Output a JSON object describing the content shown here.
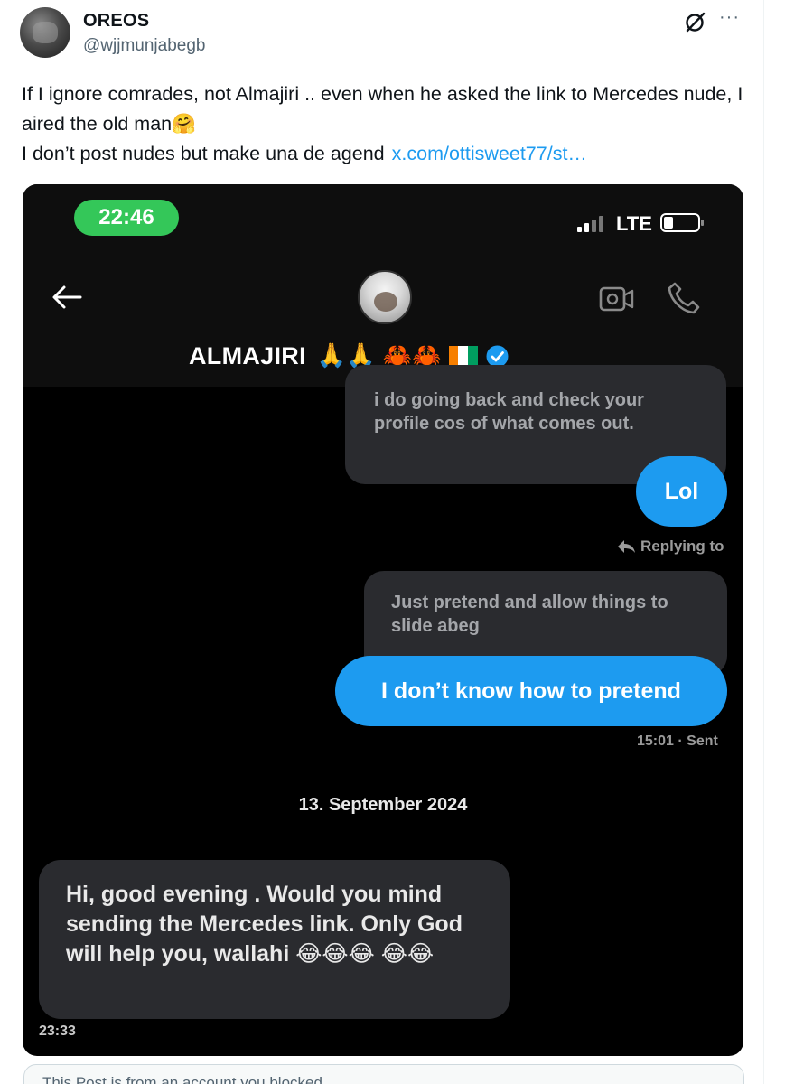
{
  "author": {
    "display_name": "OREOS",
    "handle": "@wjjmunjabegb"
  },
  "icons": {
    "grok": "grok-slash-circle-icon",
    "more": "more-options-icon"
  },
  "tweet": {
    "text": "If I ignore comrades, not Almajiri .. even when he asked the link to Mercedes nude, I aired the old man🤗\nI don’t post nudes but make una de agend",
    "link": "x.com/ottisweet77/st…"
  },
  "media": {
    "status_bar": {
      "time": "22:46",
      "network": "LTE"
    },
    "contact": {
      "name": "ALMAJIRI",
      "emoji_tail": "🙏🙏 🦀🦀"
    },
    "messages": {
      "peek_text": "i do going back and check your profile cos of what comes out.",
      "lol": "Lol",
      "replying_label": "Replying to",
      "quoted_text": "Just pretend and allow things to slide abeg",
      "pretend": "I don’t know how to pretend",
      "sent_time": "15:01 · Sent",
      "date_divider": "13. September 2024",
      "incoming": "Hi, good evening . Would you mind sending the Mercedes link. Only God will help you, wallahi 😂😂😂 😂😂",
      "incoming_time": "23:33"
    }
  },
  "colors": {
    "link": "#1d9bf0",
    "bubble_sent": "#1d9bf0",
    "bubble_dark": "#2a2b2f",
    "clock_pill": "#34c759",
    "verified": "#1d9bf0"
  },
  "notice": {
    "text": "This Post is from an account you blocked."
  }
}
